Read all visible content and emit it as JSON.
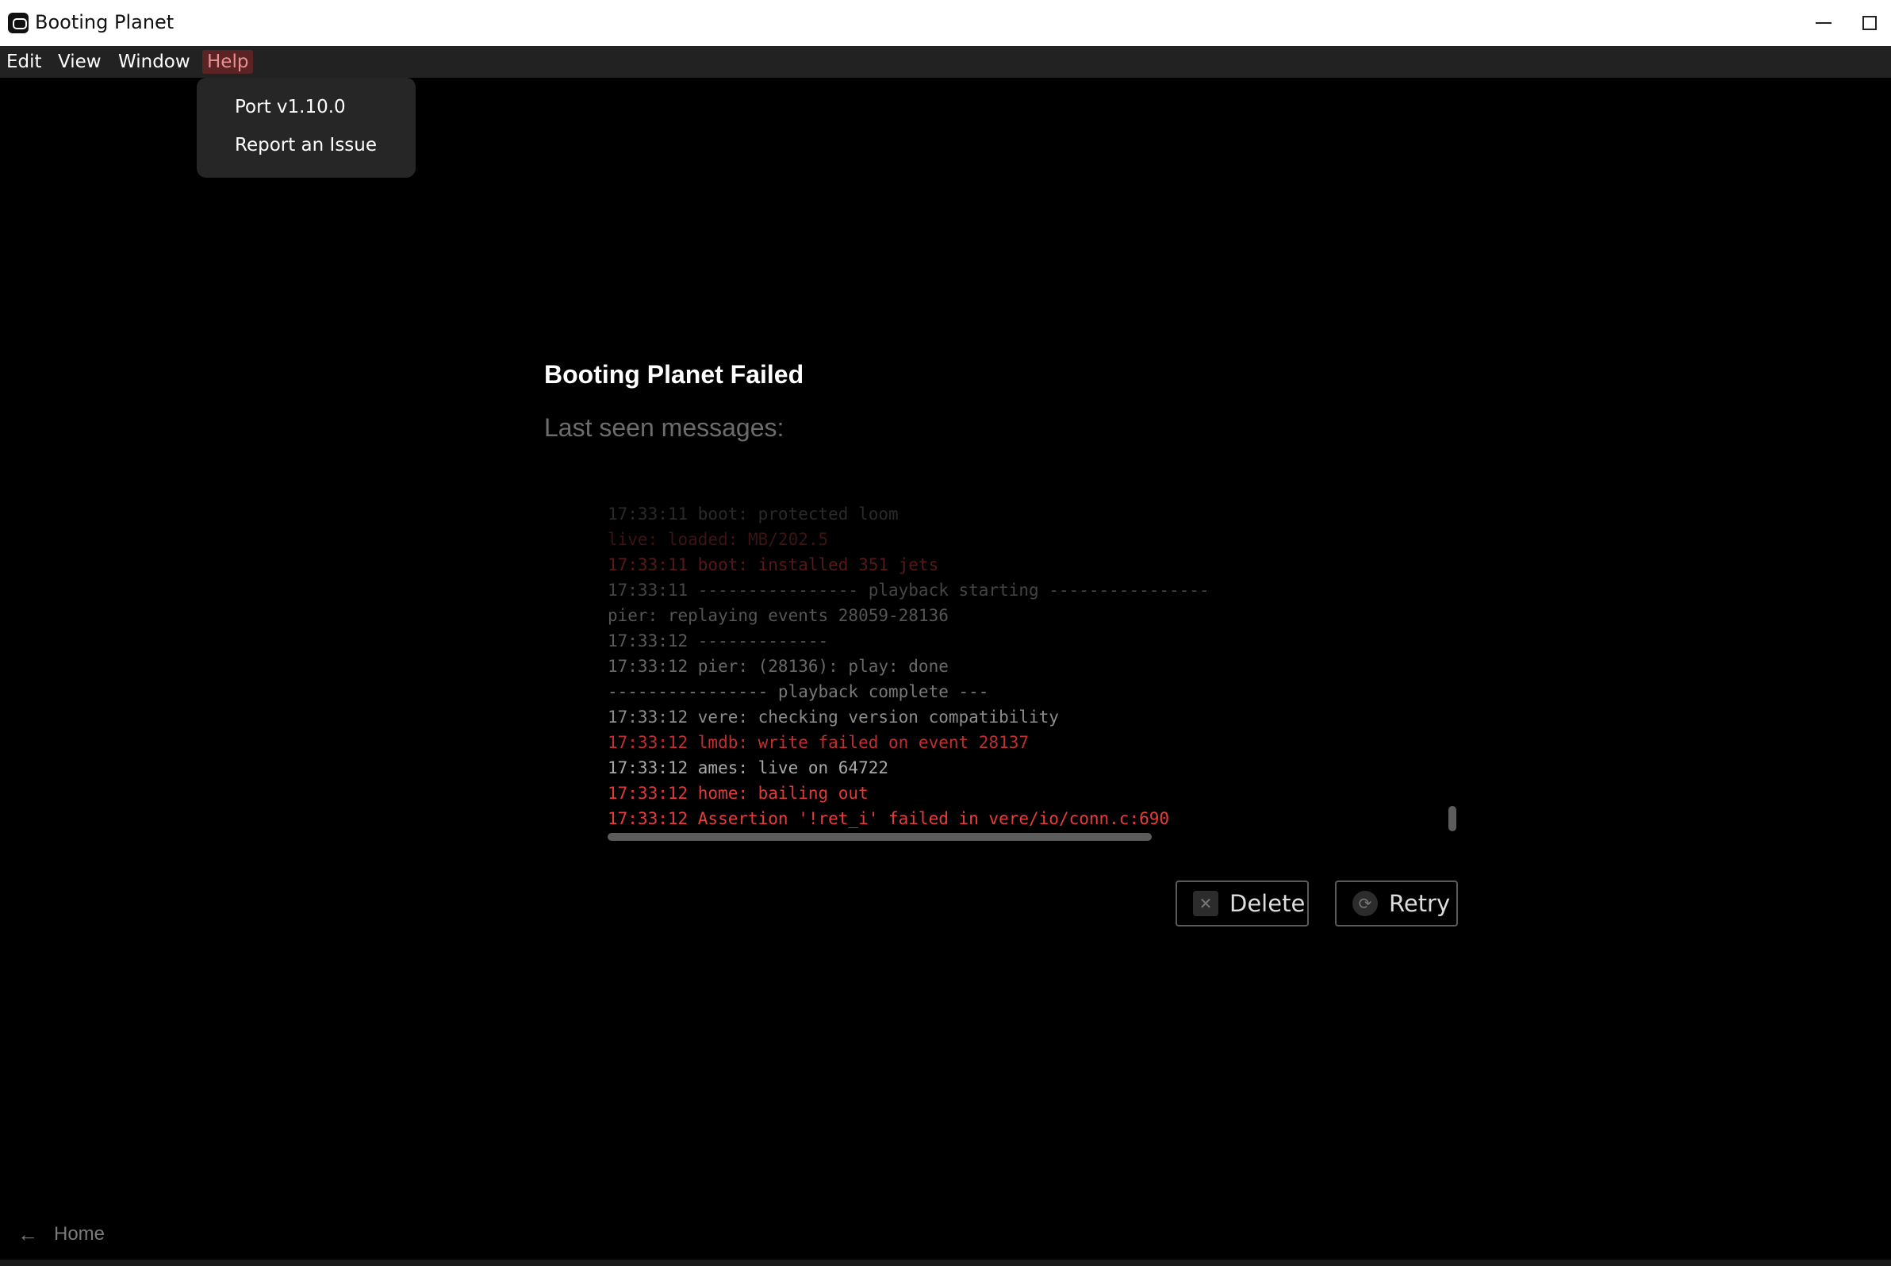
{
  "window": {
    "title": "Booting Planet"
  },
  "menubar": {
    "items": [
      {
        "label": "Edit"
      },
      {
        "label": "View"
      },
      {
        "label": "Window"
      },
      {
        "label": "Help"
      }
    ]
  },
  "help_menu": {
    "items": [
      {
        "label": "Port v1.10.0"
      },
      {
        "label": "Report an Issue"
      }
    ]
  },
  "main": {
    "title": "Booting Planet Failed",
    "subtitle": "Last seen messages:"
  },
  "log": {
    "lines": [
      {
        "text": "17:33:11 boot: protected loom",
        "color": "#2a2a2a"
      },
      {
        "text": "live: loaded: MB/202.5",
        "color": "#3a1414"
      },
      {
        "text": "17:33:11 boot: installed 351 jets",
        "color": "#561818"
      },
      {
        "text": "17:33:11 ---------------- playback starting ----------------",
        "color": "#444444"
      },
      {
        "text": "pier: replaying events 28059-28136",
        "color": "#555555"
      },
      {
        "text": "17:33:12 -------------",
        "color": "#5a5a5a"
      },
      {
        "text": "17:33:12 pier: (28136): play: done",
        "color": "#686868"
      },
      {
        "text": "---------------- playback complete ---",
        "color": "#787878"
      },
      {
        "text": "17:33:12 vere: checking version compatibility",
        "color": "#8c8c8c"
      },
      {
        "text": "17:33:12 lmdb: write failed on event 28137",
        "color": "#c03030"
      },
      {
        "text": "17:33:12 ames: live on 64722",
        "color": "#a8a8a8"
      },
      {
        "text": "17:33:12 home: bailing out",
        "color": "#de3a3a"
      },
      {
        "text": "17:33:12 Assertion '!ret_i' failed in vere/io/conn.c:690",
        "color": "#e53d3d"
      }
    ]
  },
  "actions": {
    "delete_label": "Delete",
    "retry_label": "Retry"
  },
  "footer": {
    "home_label": "Home"
  },
  "icons": {
    "app": "app-logo-icon",
    "delete": "delete-icon",
    "retry": "refresh-icon",
    "back": "arrow-left-icon"
  },
  "colors": {
    "accent_menu_bg": "#5a2424",
    "accent_menu_text": "#e98f8f",
    "error_red": "#e53d3d"
  }
}
